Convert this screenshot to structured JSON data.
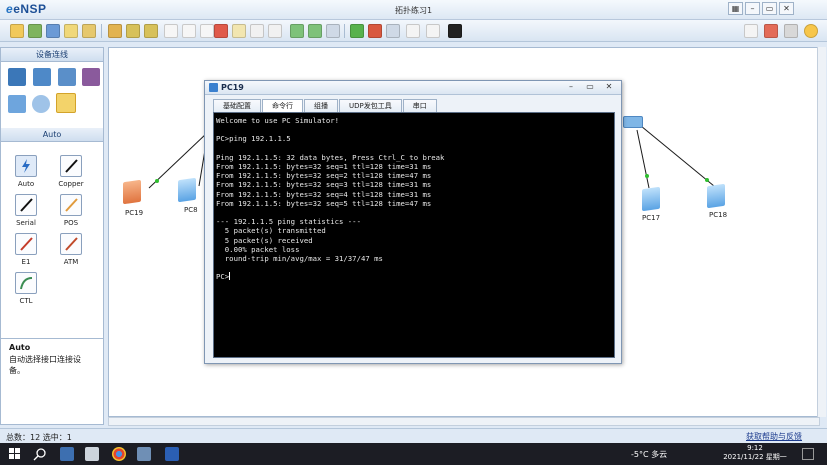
{
  "app": {
    "title": "eNSP",
    "document_title": "拓扑练习1"
  },
  "window_controls": {
    "minimize": "–",
    "maximize": "▭",
    "close": "✕"
  },
  "left_panel": {
    "devices_header": "设备连线",
    "connections_header": "Auto",
    "connections": [
      {
        "label": "Auto",
        "icon": "lightning-icon"
      },
      {
        "label": "Copper",
        "icon": "cable-copper-icon"
      },
      {
        "label": "Serial",
        "icon": "cable-serial-icon"
      },
      {
        "label": "POS",
        "icon": "cable-pos-icon"
      },
      {
        "label": "E1",
        "icon": "cable-e1-icon"
      },
      {
        "label": "ATM",
        "icon": "cable-atm-icon"
      },
      {
        "label": "CTL",
        "icon": "cable-ctl-icon"
      }
    ],
    "info_title": "Auto",
    "info_description": "自动选择接口连接设备。"
  },
  "canvas": {
    "nodes": [
      {
        "label": "PC19"
      },
      {
        "label": "PC8"
      },
      {
        "label": "PC17"
      },
      {
        "label": "PC18"
      }
    ]
  },
  "pc_window": {
    "title": "PC19",
    "tabs": [
      "基础配置",
      "命令行",
      "组播",
      "UDP发包工具",
      "串口"
    ],
    "active_tab": "命令行",
    "terminal_lines": [
      "Welcome to use PC Simulator!",
      "",
      "PC>ping 192.1.1.5",
      "",
      "Ping 192.1.1.5: 32 data bytes, Press Ctrl_C to break",
      "From 192.1.1.5: bytes=32 seq=1 ttl=128 time=31 ms",
      "From 192.1.1.5: bytes=32 seq=2 ttl=128 time=47 ms",
      "From 192.1.1.5: bytes=32 seq=3 ttl=128 time=31 ms",
      "From 192.1.1.5: bytes=32 seq=4 ttl=128 time=31 ms",
      "From 192.1.1.5: bytes=32 seq=5 ttl=128 time=47 ms",
      "",
      "--- 192.1.1.5 ping statistics ---",
      "  5 packet(s) transmitted",
      "  5 packet(s) received",
      "  0.00% packet loss",
      "  round-trip min/avg/max = 31/37/47 ms",
      "",
      "PC>"
    ]
  },
  "status_bar": {
    "left": "总数：12  选中：1",
    "right": "获取帮助与反馈"
  },
  "taskbar": {
    "weather": "-5°C  多云",
    "time": "9:12",
    "date": "2021/11/22 星期一"
  },
  "colors": {
    "accent": "#1c4f96",
    "terminal_bg": "#000000",
    "terminal_fg": "#e8e8e8",
    "window_bg": "#dfe9f5"
  }
}
